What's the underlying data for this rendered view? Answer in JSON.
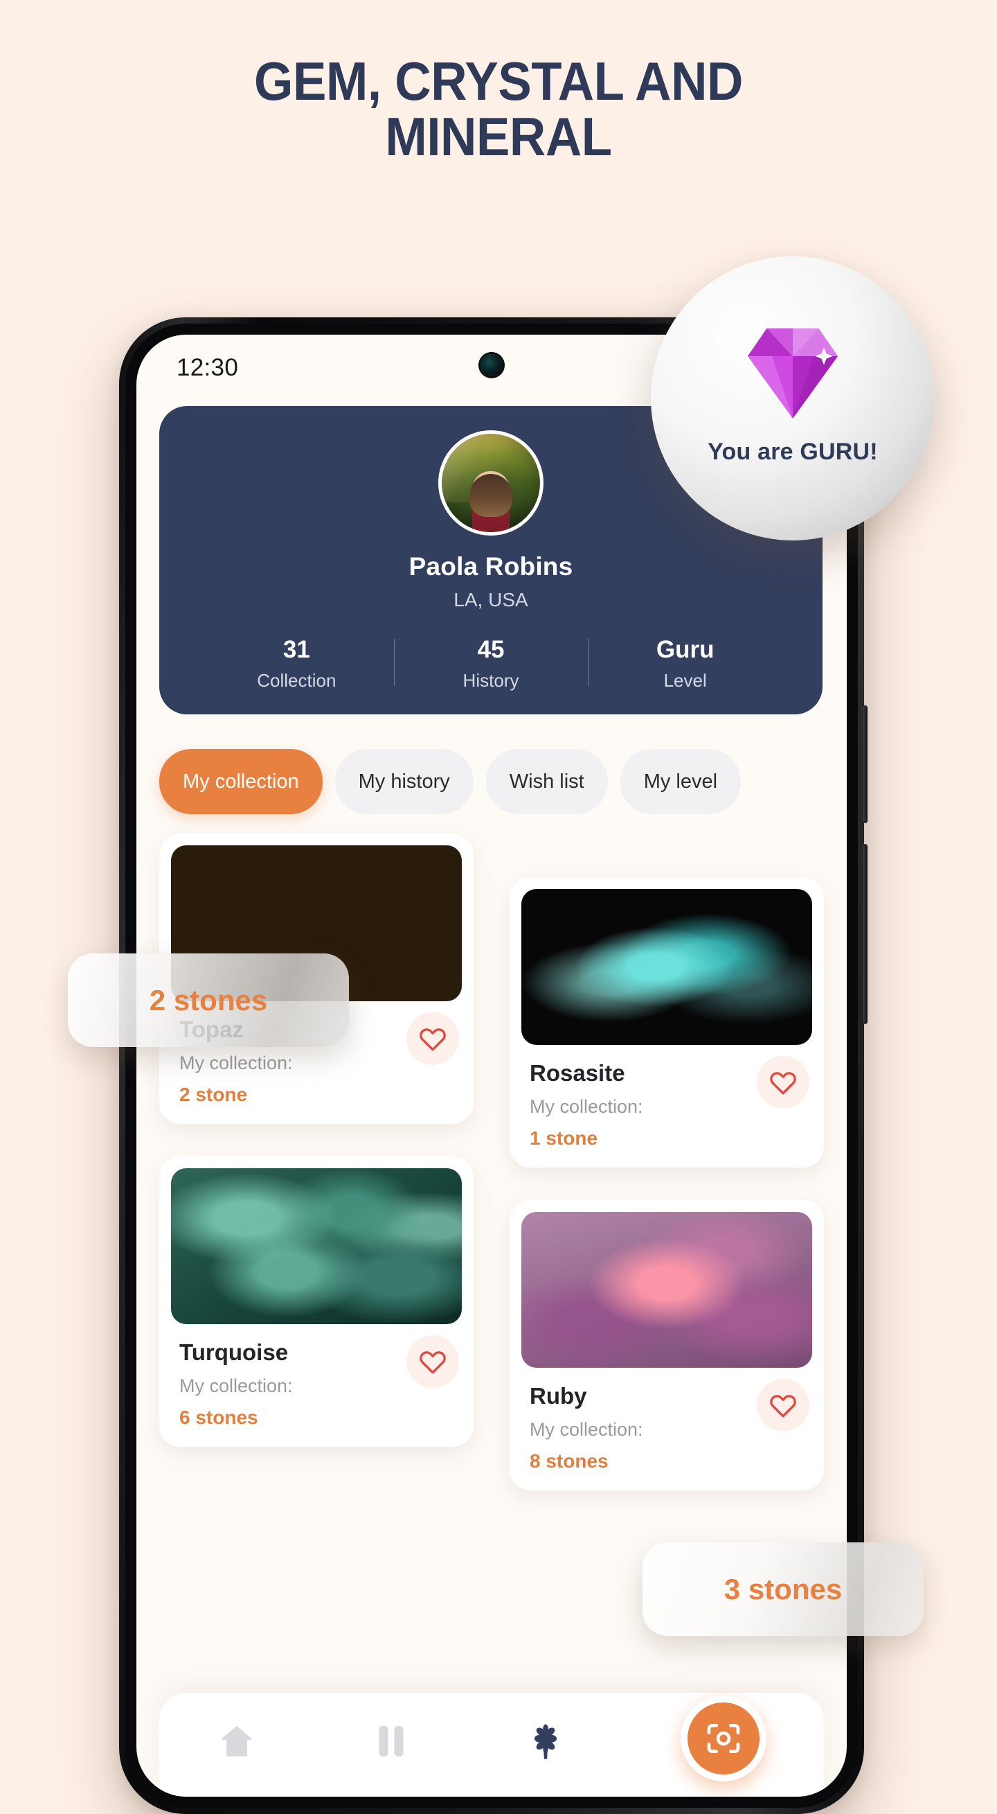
{
  "hero": {
    "line1": "GEM, CRYSTAL AND",
    "line2": "MINERAL"
  },
  "colors": {
    "page_background": "#fdf0e7",
    "accent_orange": "#e8803f",
    "navy": "#333f5e",
    "heart_red": "#e2483f",
    "diamond_purple": "#c23bd8"
  },
  "status_bar": {
    "time": "12:30"
  },
  "profile": {
    "name": "Paola Robins",
    "location": "LA, USA",
    "avatar_alt": "woman-in-forest-avatar",
    "stats": [
      {
        "value": "31",
        "label": "Collection"
      },
      {
        "value": "45",
        "label": "History"
      },
      {
        "value": "Guru",
        "label": "Level"
      }
    ]
  },
  "tabs": [
    {
      "label": "My collection",
      "active": true
    },
    {
      "label": "My history",
      "active": false
    },
    {
      "label": "Wish list",
      "active": false
    },
    {
      "label": "My level",
      "active": false
    }
  ],
  "collection": {
    "subtitle_label": "My collection:",
    "items": [
      {
        "name": "Topaz",
        "count_text": "2 stone",
        "photo": "golden-topaz-crystals",
        "column": "left"
      },
      {
        "name": "Rosasite",
        "count_text": "1 stone",
        "photo": "teal-rosasite-specimen",
        "column": "right"
      },
      {
        "name": "Turquoise",
        "count_text": "6 stones",
        "photo": "green-turquoise-tumbled-stones",
        "column": "left"
      },
      {
        "name": "Ruby",
        "count_text": "8 stones",
        "photo": "pink-ruby-gemstones",
        "column": "right"
      }
    ]
  },
  "bottom_nav": {
    "items": [
      {
        "icon": "home-icon",
        "state": "inactive"
      },
      {
        "icon": "bookmark-icon",
        "state": "inactive"
      },
      {
        "icon": "star-icon",
        "state": "active"
      }
    ],
    "fab": {
      "icon": "camera-icon",
      "label": ""
    }
  },
  "overlays": {
    "guru_badge": {
      "text": "You are GURU!",
      "icon": "diamond-icon"
    },
    "pill_left": {
      "text": "2 stones"
    },
    "pill_right": {
      "text": "3 stones"
    }
  }
}
